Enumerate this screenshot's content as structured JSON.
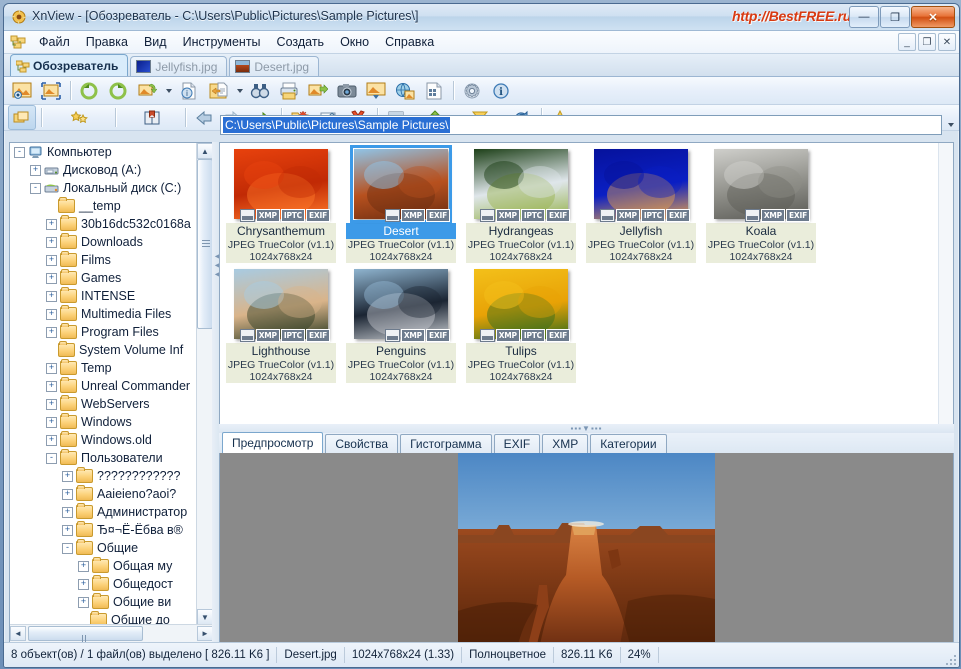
{
  "window": {
    "title": "XnView - [Обозреватель - C:\\Users\\Public\\Pictures\\Sample Pictures\\]",
    "watermark": "http://BestFREE.ru",
    "buttons": {
      "minimize": "—",
      "maximize": "❐",
      "close": "✕"
    },
    "mdi_buttons": {
      "minimize": "_",
      "restore": "❐",
      "close": "✕"
    }
  },
  "menu": {
    "items": [
      {
        "label": "Файл"
      },
      {
        "label": "Правка"
      },
      {
        "label": "Вид"
      },
      {
        "label": "Инструменты"
      },
      {
        "label": "Создать"
      },
      {
        "label": "Окно"
      },
      {
        "label": "Справка"
      }
    ]
  },
  "doc_tabs": [
    {
      "label": "Обозреватель",
      "active": true,
      "icon": "browser-icon"
    },
    {
      "label": "Jellyfish.jpg",
      "active": false,
      "icon": "image-thumb-icon"
    },
    {
      "label": "Desert.jpg",
      "active": false,
      "icon": "image-thumb-icon"
    }
  ],
  "toolbar_main": [
    {
      "name": "view-image-button",
      "icon": "image-view-icon"
    },
    {
      "name": "fit-image-button",
      "icon": "fit-window-icon"
    },
    {
      "name": "rotate-left-button",
      "icon": "rotate-left-icon"
    },
    {
      "name": "rotate-right-button",
      "icon": "rotate-right-icon"
    },
    {
      "name": "convert-button",
      "icon": "convert-icon",
      "has_dropdown": true
    },
    {
      "name": "info-document-button",
      "icon": "document-info-icon"
    },
    {
      "name": "export-button",
      "icon": "export-icon",
      "has_dropdown": true
    },
    {
      "name": "find-button",
      "icon": "binoculars-icon"
    },
    {
      "name": "print-button",
      "icon": "printer-icon"
    },
    {
      "name": "batch-convert-button",
      "icon": "batch-convert-icon"
    },
    {
      "name": "capture-button",
      "icon": "camera-icon"
    },
    {
      "name": "slideshow-button",
      "icon": "slideshow-icon"
    },
    {
      "name": "web-page-button",
      "icon": "web-globe-icon"
    },
    {
      "name": "contact-sheet-button",
      "icon": "contact-sheet-icon"
    },
    {
      "name": "settings-button",
      "icon": "gear-icon"
    },
    {
      "name": "about-button",
      "icon": "info-circle-icon"
    }
  ],
  "toolbar_browser": [
    {
      "name": "browser-view-button",
      "icon": "folders-icon"
    },
    {
      "name": "favorites-button",
      "icon": "star-folder-icon"
    },
    {
      "name": "catalog-button",
      "icon": "book-icon"
    },
    {
      "name": "back-button",
      "icon": "arrow-left-icon"
    },
    {
      "name": "forward-button",
      "icon": "arrow-right-icon"
    },
    {
      "name": "up-button",
      "icon": "arrow-up-folder-icon"
    },
    {
      "name": "new-folder-button",
      "icon": "new-folder-icon"
    },
    {
      "name": "rename-button",
      "icon": "rename-icon"
    },
    {
      "name": "delete-button",
      "icon": "delete-x-icon"
    },
    {
      "name": "view-mode-button",
      "icon": "grid-view-icon",
      "has_dropdown": true
    },
    {
      "name": "sort-button",
      "icon": "sort-icon",
      "has_dropdown": true
    },
    {
      "name": "filter-button",
      "icon": "funnel-icon",
      "has_dropdown": true
    },
    {
      "name": "refresh-button",
      "icon": "refresh-icon"
    },
    {
      "name": "add-favorite-button",
      "icon": "star-icon",
      "has_dropdown": true
    }
  ],
  "address": {
    "value": "C:\\Users\\Public\\Pictures\\Sample Pictures\\",
    "dropdown_icon": "chevron-down-icon"
  },
  "tree": {
    "root": "Компьютер",
    "items": [
      {
        "label": "Компьютер",
        "depth": 0,
        "expander": "-",
        "icon": "computer-icon"
      },
      {
        "label": "Дисковод (A:)",
        "depth": 1,
        "expander": "+",
        "icon": "floppy-drive-icon"
      },
      {
        "label": "Локальный диск (C:)",
        "depth": 1,
        "expander": "-",
        "icon": "hard-drive-icon"
      },
      {
        "label": "__temp",
        "depth": 2,
        "expander": "",
        "icon": "folder-icon"
      },
      {
        "label": "30b16dc532c0168a",
        "depth": 2,
        "expander": "+",
        "icon": "folder-icon"
      },
      {
        "label": "Downloads",
        "depth": 2,
        "expander": "+",
        "icon": "folder-icon"
      },
      {
        "label": "Films",
        "depth": 2,
        "expander": "+",
        "icon": "folder-icon"
      },
      {
        "label": "Games",
        "depth": 2,
        "expander": "+",
        "icon": "folder-icon"
      },
      {
        "label": "INTENSE",
        "depth": 2,
        "expander": "+",
        "icon": "folder-icon"
      },
      {
        "label": "Multimedia Files",
        "depth": 2,
        "expander": "+",
        "icon": "folder-icon"
      },
      {
        "label": "Program Files",
        "depth": 2,
        "expander": "+",
        "icon": "folder-icon"
      },
      {
        "label": "System Volume Inf",
        "depth": 2,
        "expander": "",
        "icon": "folder-icon"
      },
      {
        "label": "Temp",
        "depth": 2,
        "expander": "+",
        "icon": "folder-icon"
      },
      {
        "label": "Unreal Commander",
        "depth": 2,
        "expander": "+",
        "icon": "folder-icon"
      },
      {
        "label": "WebServers",
        "depth": 2,
        "expander": "+",
        "icon": "folder-icon"
      },
      {
        "label": "Windows",
        "depth": 2,
        "expander": "+",
        "icon": "folder-icon"
      },
      {
        "label": "Windows.old",
        "depth": 2,
        "expander": "+",
        "icon": "folder-icon"
      },
      {
        "label": "Пользователи",
        "depth": 2,
        "expander": "-",
        "icon": "folder-icon"
      },
      {
        "label": "????????????",
        "depth": 3,
        "expander": "+",
        "icon": "folder-icon"
      },
      {
        "label": "Aaieieno?aoi?",
        "depth": 3,
        "expander": "+",
        "icon": "folder-icon"
      },
      {
        "label": "Администратор",
        "depth": 3,
        "expander": "+",
        "icon": "folder-icon"
      },
      {
        "label": "Ђ¤¬Ё-Ёбва в®",
        "depth": 3,
        "expander": "+",
        "icon": "folder-icon"
      },
      {
        "label": "Общие",
        "depth": 3,
        "expander": "-",
        "icon": "folder-icon"
      },
      {
        "label": "Общая му",
        "depth": 4,
        "expander": "+",
        "icon": "folder-icon"
      },
      {
        "label": "Общедост",
        "depth": 4,
        "expander": "+",
        "icon": "folder-icon"
      },
      {
        "label": "Общие ви",
        "depth": 4,
        "expander": "+",
        "icon": "folder-icon"
      },
      {
        "label": "Общие до",
        "depth": 4,
        "expander": "",
        "icon": "folder-icon"
      }
    ]
  },
  "thumbnails": [
    {
      "name": "Chrysanthemum",
      "format": "JPEG TrueColor (v1.1)",
      "dimensions": "1024x768x24",
      "selected": false,
      "badges": [
        "sq",
        "XMP",
        "IPTC",
        "EXIF"
      ],
      "colors": [
        "#e8420d",
        "#c12a05",
        "#ff7a2a"
      ]
    },
    {
      "name": "Desert",
      "format": "JPEG TrueColor (v1.1)",
      "dimensions": "1024x768x24",
      "selected": true,
      "badges": [
        "sq",
        "XMP",
        "EXIF"
      ],
      "colors": [
        "#8fc4e8",
        "#b7511f",
        "#6b2c10"
      ]
    },
    {
      "name": "Hydrangeas",
      "format": "JPEG TrueColor (v1.1)",
      "dimensions": "1024x768x24",
      "selected": false,
      "badges": [
        "sq",
        "XMP",
        "IPTC",
        "EXIF"
      ],
      "colors": [
        "#1d4018",
        "#dfe6ea",
        "#96b24a"
      ]
    },
    {
      "name": "Jellyfish",
      "format": "JPEG TrueColor (v1.1)",
      "dimensions": "1024x768x24",
      "selected": false,
      "badges": [
        "sq",
        "XMP",
        "IPTC",
        "EXIF"
      ],
      "colors": [
        "#06129c",
        "#0a1fc4",
        "#e8a24a"
      ]
    },
    {
      "name": "Koala",
      "format": "JPEG TrueColor (v1.1)",
      "dimensions": "1024x768x24",
      "selected": false,
      "badges": [
        "sq",
        "XMP",
        "EXIF"
      ],
      "colors": [
        "#cfcfcb",
        "#8e8e88",
        "#5a5a55"
      ]
    },
    {
      "name": "Lighthouse",
      "format": "JPEG TrueColor (v1.1)",
      "dimensions": "1024x768x24",
      "selected": false,
      "badges": [
        "sq",
        "XMP",
        "IPTC",
        "EXIF"
      ],
      "colors": [
        "#a8cbe2",
        "#d9b48a",
        "#2a3a22"
      ]
    },
    {
      "name": "Penguins",
      "format": "JPEG TrueColor (v1.1)",
      "dimensions": "1024x768x24",
      "selected": false,
      "badges": [
        "sq",
        "XMP",
        "EXIF"
      ],
      "colors": [
        "#8fb4cf",
        "#1b2533",
        "#c9cdd2"
      ]
    },
    {
      "name": "Tulips",
      "format": "JPEG TrueColor (v1.1)",
      "dimensions": "1024x768x24",
      "selected": false,
      "badges": [
        "sq",
        "XMP",
        "IPTC",
        "EXIF"
      ],
      "colors": [
        "#f3c01a",
        "#e8a206",
        "#2f6b1c"
      ]
    }
  ],
  "bottom_tabs": [
    {
      "label": "Предпросмотр",
      "active": true
    },
    {
      "label": "Свойства",
      "active": false
    },
    {
      "label": "Гистограмма",
      "active": false
    },
    {
      "label": "EXIF",
      "active": false
    },
    {
      "label": "XMP",
      "active": false
    },
    {
      "label": "Категории",
      "active": false
    }
  ],
  "preview": {
    "image_name": "Desert.jpg",
    "background": "#8a8a8a"
  },
  "statusbar": {
    "cells": [
      "8 объект(ов) / 1 файл(ов) выделено  [ 826.11 K6 ]",
      "Desert.jpg",
      "1024x768x24 (1.33)",
      "Полноцветное",
      "826.11 K6",
      "24%"
    ]
  },
  "colors": {
    "accent": "#3c9ae8",
    "address_highlight": "#2a6fd4",
    "watermark": "#d83a12",
    "thumb_label_bg": "#eaeddb"
  }
}
